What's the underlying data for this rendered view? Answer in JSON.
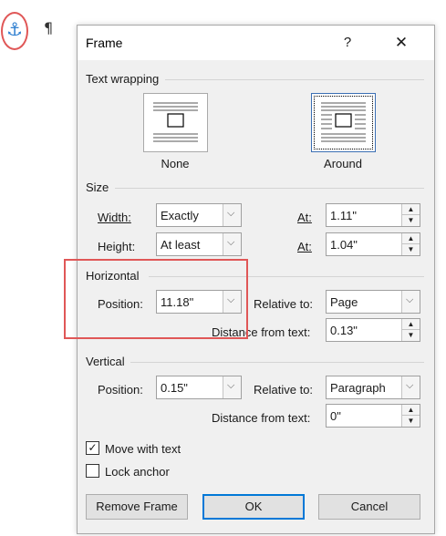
{
  "document": {
    "anchor_icon": "anchor-icon",
    "pilcrow": "¶"
  },
  "dialog": {
    "title": "Frame",
    "help_label": "?",
    "close_label": "✕",
    "text_wrapping": {
      "section_title": "Text wrapping",
      "options": [
        {
          "label": "None",
          "selected": false
        },
        {
          "label": "Around",
          "selected": true
        }
      ]
    },
    "size": {
      "section_title": "Size",
      "width": {
        "label": "Width:",
        "value": "Exactly",
        "at_label": "At:",
        "at_value": "1.11\""
      },
      "height": {
        "label": "Height:",
        "value": "At least",
        "at_label": "At:",
        "at_value": "1.04\""
      }
    },
    "horizontal": {
      "section_title": "Horizontal",
      "position_label": "Position:",
      "position_value": "11.18\"",
      "relative_label": "Relative to:",
      "relative_value": "Page",
      "distance_label": "Distance from text:",
      "distance_value": "0.13\""
    },
    "vertical": {
      "section_title": "Vertical",
      "position_label": "Position:",
      "position_value": "0.15\"",
      "relative_label": "Relative to:",
      "relative_value": "Paragraph",
      "distance_label": "Distance from text:",
      "distance_value": "0\""
    },
    "options": {
      "move_with_text": {
        "label": "Move with text",
        "checked": true
      },
      "lock_anchor": {
        "label": "Lock anchor",
        "checked": false
      }
    },
    "buttons": {
      "remove": "Remove Frame",
      "ok": "OK",
      "cancel": "Cancel"
    },
    "glyphs": {
      "chevron": "⌵",
      "spin_up": "▲",
      "spin_down": "▼",
      "check": "✓"
    }
  },
  "colors": {
    "highlight": "#e05757",
    "accent": "#0078d7",
    "anchor": "#2f7fd0"
  }
}
